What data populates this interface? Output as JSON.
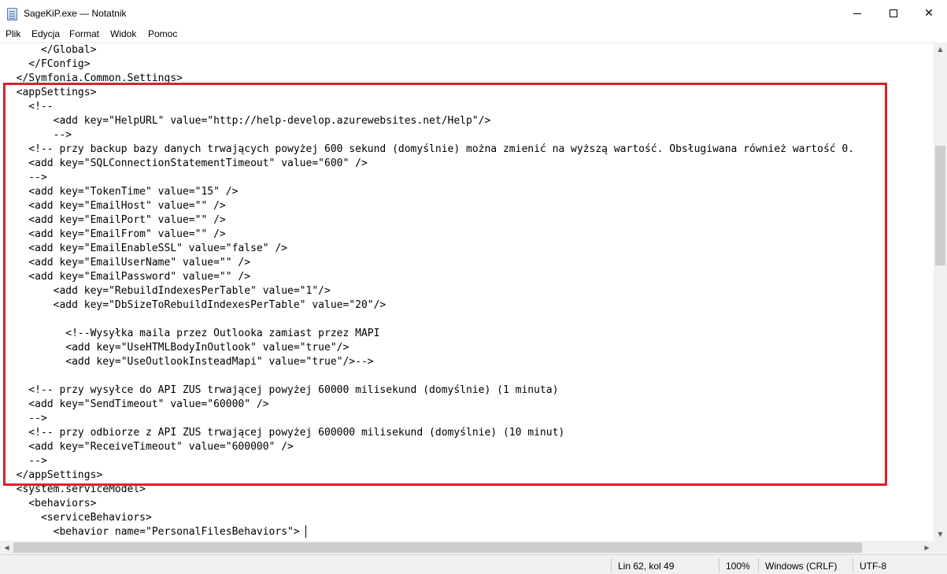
{
  "window": {
    "title": "SageKiP.exe — Notatnik",
    "minimize_icon": "minimize-icon",
    "maximize_icon": "maximize-icon",
    "close_glyph": "✕"
  },
  "menu": {
    "items": [
      "Plik",
      "Edycja",
      "Format",
      "Widok",
      "Pomoc"
    ]
  },
  "editor": {
    "lines": [
      "      </Global>",
      "    </FConfig>",
      "  </Symfonia.Common.Settings>",
      "  <appSettings>",
      "    <!--",
      "        <add key=\"HelpURL\" value=\"http://help-develop.azurewebsites.net/Help\"/>",
      "        -->",
      "    <!-- przy backup bazy danych trwających powyżej 600 sekund (domyślnie) można zmienić na wyższą wartość. Obsługiwana również wartość 0.",
      "    <add key=\"SQLConnectionStatementTimeout\" value=\"600\" />",
      "    -->",
      "    <add key=\"TokenTime\" value=\"15\" />",
      "    <add key=\"EmailHost\" value=\"\" />",
      "    <add key=\"EmailPort\" value=\"\" />",
      "    <add key=\"EmailFrom\" value=\"\" />",
      "    <add key=\"EmailEnableSSL\" value=\"false\" />",
      "    <add key=\"EmailUserName\" value=\"\" />",
      "    <add key=\"EmailPassword\" value=\"\" />",
      "        <add key=\"RebuildIndexesPerTable\" value=\"1\"/>",
      "        <add key=\"DbSizeToRebuildIndexesPerTable\" value=\"20\"/>",
      "",
      "          <!--Wysyłka maila przez Outlooka zamiast przez MAPI",
      "          <add key=\"UseHTMLBodyInOutlook\" value=\"true\"/>",
      "          <add key=\"UseOutlookInsteadMapi\" value=\"true\"/>-->",
      "",
      "    <!-- przy wysyłce do API ZUS trwającej powyżej 60000 milisekund (domyślnie) (1 minuta)",
      "    <add key=\"SendTimeout\" value=\"60000\" />",
      "    -->",
      "    <!-- przy odbiorze z API ZUS trwającej powyżej 600000 milisekund (domyślnie) (10 minut)",
      "    <add key=\"ReceiveTimeout\" value=\"600000\" />",
      "    -->",
      "  </appSettings>",
      "  <system.serviceModel>",
      "    <behaviors>",
      "      <serviceBehaviors>",
      "        <behavior name=\"PersonalFilesBehaviors\">"
    ],
    "highlight_color": "#d9212a"
  },
  "statusbar": {
    "position": "Lin 62, kol 49",
    "zoom": "100%",
    "line_ending": "Windows (CRLF)",
    "encoding": "UTF-8"
  }
}
